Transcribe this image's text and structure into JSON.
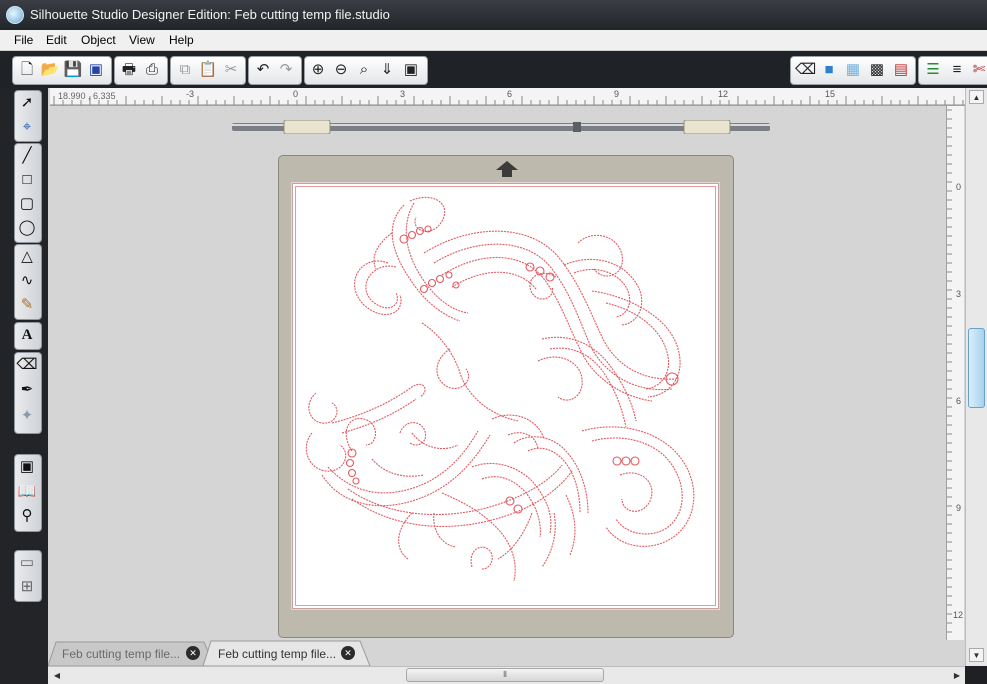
{
  "window": {
    "title": "Silhouette Studio Designer Edition: Feb cutting temp file.studio",
    "app_icon": "silhouette-logo-icon"
  },
  "menu": {
    "items": [
      "File",
      "Edit",
      "Object",
      "View",
      "Help"
    ]
  },
  "toolbar": {
    "groups": [
      [
        "new-file-icon",
        "open-folder-icon",
        "save-icon",
        "save-to-sd-icon"
      ],
      [
        "print-icon",
        "print-and-cut-icon"
      ],
      [
        "copy-icon",
        "paste-icon",
        "cut-scissors-icon"
      ],
      [
        "undo-icon",
        "redo-icon"
      ],
      [
        "zoom-in-icon",
        "zoom-out-icon",
        "zoom-select-icon",
        "pan-icon",
        "fit-to-page-icon"
      ],
      [
        "eraser-fill-icon",
        "fill-color-icon",
        "fill-pattern-icon",
        "gradient-icon",
        "line-style-icon"
      ],
      [
        "line-color-icon",
        "line-width-icon",
        "cut-style-icon"
      ]
    ]
  },
  "left_tools": {
    "groups": [
      [
        "select-arrow-icon",
        "edit-points-icon"
      ],
      [
        "line-tool-icon",
        "rectangle-tool-icon",
        "rounded-rectangle-tool-icon",
        "ellipse-tool-icon"
      ],
      [
        "polygon-tool-icon",
        "curve-tool-icon",
        "freehand-tool-icon"
      ],
      [
        "text-tool-icon"
      ],
      [
        "eraser-tool-icon",
        "knife-tool-icon",
        "trace-tool-icon"
      ],
      [
        "page-settings-icon",
        "library-icon",
        "store-icon"
      ],
      [
        "panel-toggle-icon",
        "grid-toggle-icon"
      ]
    ]
  },
  "ruler": {
    "coordinates": "18.990 , 6.335",
    "h_numbers": [
      "-3",
      "0",
      "3",
      "6",
      "9",
      "12",
      "15"
    ],
    "v_numbers": [
      "0",
      "3",
      "6",
      "9",
      "12"
    ]
  },
  "documents": {
    "tabs": [
      {
        "label": "Feb cutting temp file...",
        "active": false
      },
      {
        "label": "Feb cutting temp file...",
        "active": true
      }
    ],
    "close_glyph": "✕"
  },
  "design": {
    "stroke_color": "#e05a60",
    "mat_color": "#bdb9ad"
  }
}
